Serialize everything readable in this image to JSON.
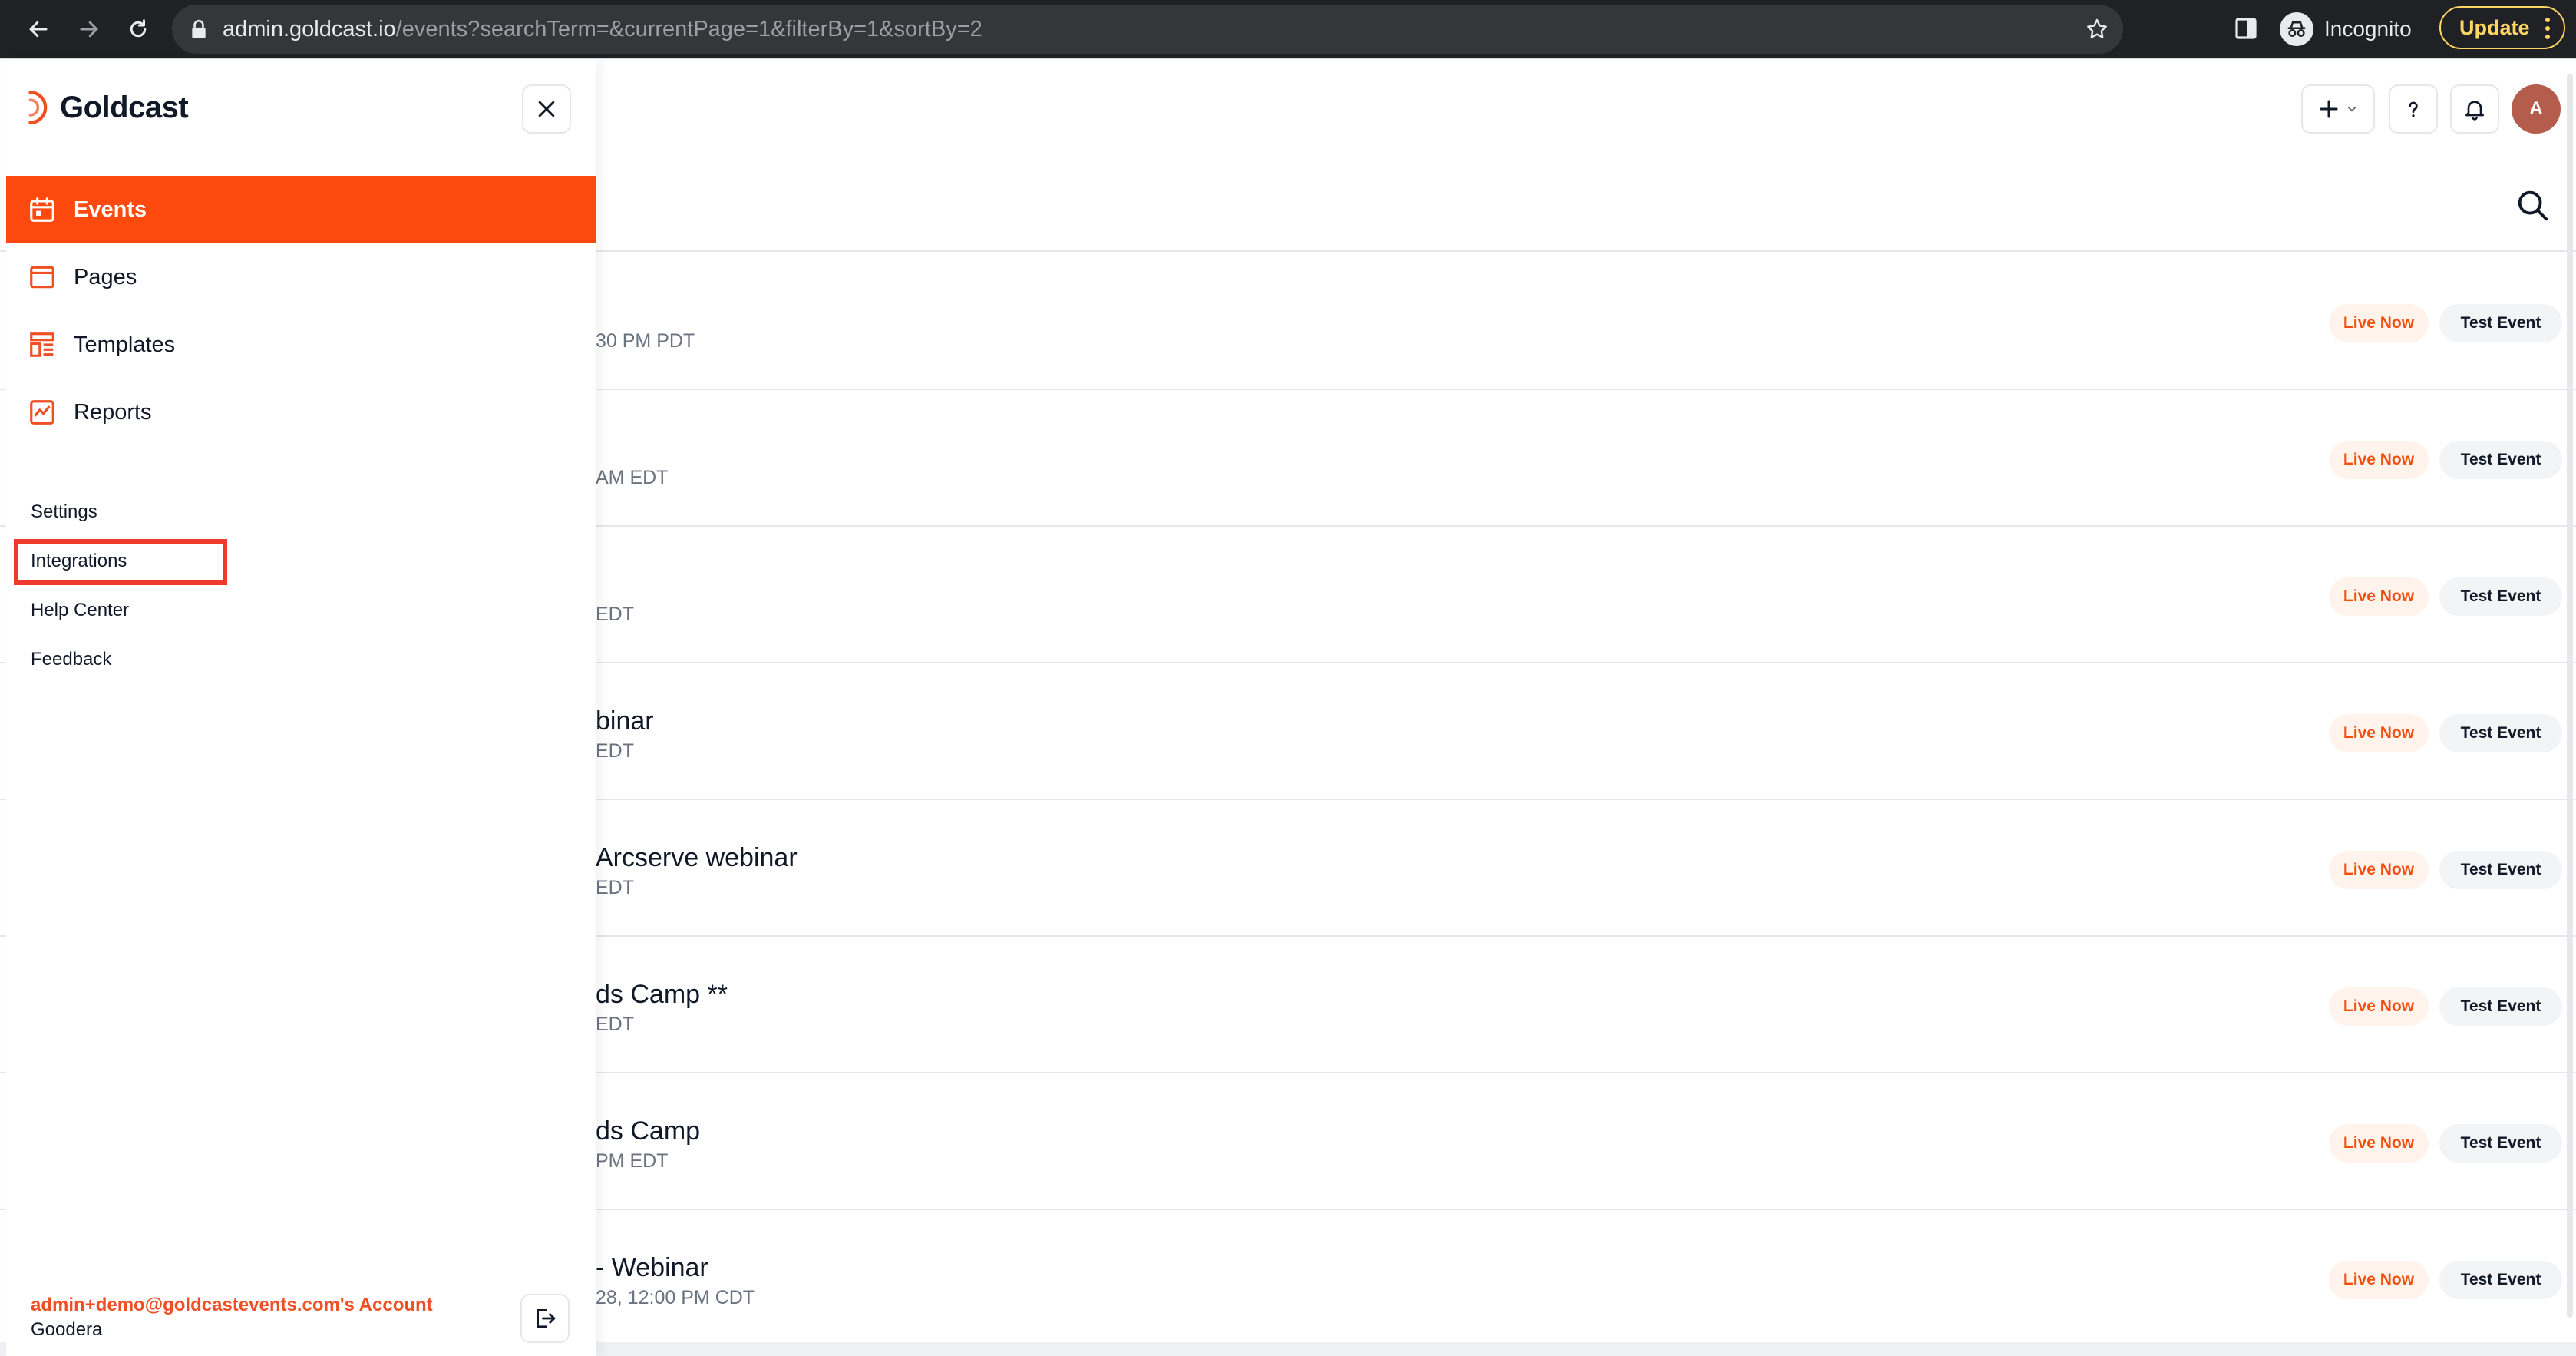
{
  "browser": {
    "url_host": "admin.goldcast.io",
    "url_path": "/events?searchTerm=&currentPage=1&filterBy=1&sortBy=2",
    "incognito_label": "Incognito",
    "update_label": "Update"
  },
  "header": {
    "avatar_initial": "A"
  },
  "drawer": {
    "brand": "Goldcast",
    "nav": [
      {
        "label": "Events",
        "icon": "calendar-icon",
        "active": true
      },
      {
        "label": "Pages",
        "icon": "page-icon",
        "active": false
      },
      {
        "label": "Templates",
        "icon": "template-icon",
        "active": false
      },
      {
        "label": "Reports",
        "icon": "chart-icon",
        "active": false
      }
    ],
    "links": [
      "Settings",
      "Integrations",
      "Help Center",
      "Feedback"
    ],
    "account_email": "admin+demo@goldcastevents.com's Account",
    "account_org": "Goodera"
  },
  "events": [
    {
      "title": "",
      "date": "30 PM PDT"
    },
    {
      "title": "",
      "date": "AM EDT"
    },
    {
      "title": "",
      "date": "EDT"
    },
    {
      "title": "binar",
      "date": "EDT"
    },
    {
      "title": "Arcserve webinar",
      "date": "EDT"
    },
    {
      "title": "ds Camp **",
      "date": "EDT"
    },
    {
      "title": "ds Camp",
      "date": "PM EDT"
    },
    {
      "title": "- Webinar",
      "date": "28, 12:00 PM CDT"
    }
  ],
  "badges": {
    "live": "Live Now",
    "test": "Test Event"
  },
  "colors": {
    "brand": "#ff4a0f",
    "highlight": "#ef3b2d"
  }
}
